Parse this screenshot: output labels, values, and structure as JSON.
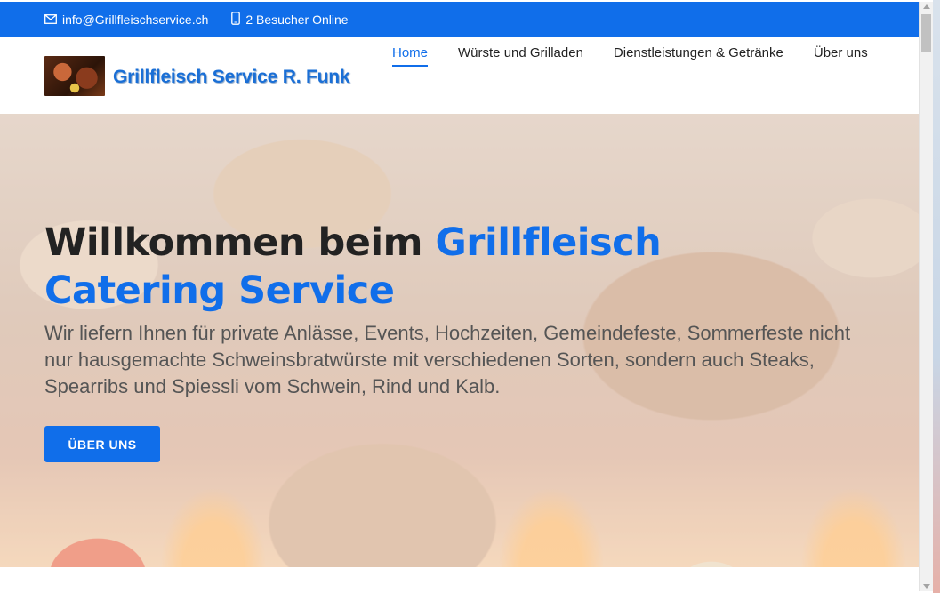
{
  "topbar": {
    "email_icon": "envelope-icon",
    "email": "info@Grillfleischservice.ch",
    "visitors_icon": "phone-icon",
    "visitors": "2 Besucher Online"
  },
  "header": {
    "logo_text": "Grillfleisch Service R. Funk",
    "nav": [
      {
        "label": "Home",
        "active": true
      },
      {
        "label": "Würste und Grilladen"
      },
      {
        "label": "Dienstleistungen & Getränke"
      },
      {
        "label": "Über uns"
      }
    ]
  },
  "hero": {
    "title_part1": "Willkommen beim ",
    "title_accent1": "Grillfleisch",
    "title_accent2": "Catering Service",
    "text": "Wir liefern Ihnen für private Anlässe, Events, Hochzeiten, Gemeindefeste, Sommerfeste nicht nur hausgemachte Schweinsbratwürste mit verschiedenen Sorten, sondern auch Steaks, Spearribs und Spiessli vom Schwein, Rind und Kalb.",
    "button_label": "ÜBER UNS"
  },
  "colors": {
    "accent": "#106eea",
    "heading": "#222222"
  }
}
